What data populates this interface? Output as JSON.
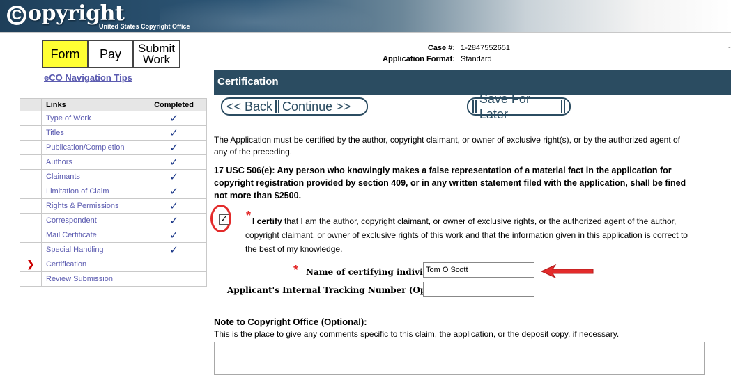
{
  "header": {
    "logo_text": "opyright",
    "logo_c": "C",
    "subtitle": "United States Copyright Office"
  },
  "tabs": [
    {
      "label": "Form",
      "active": true
    },
    {
      "label": "Pay",
      "active": false
    },
    {
      "label_line1": "Submit",
      "label_line2": "Work",
      "active": false
    }
  ],
  "nav_tips": "eCO Navigation Tips",
  "links_table": {
    "headers": [
      "",
      "Links",
      "Completed"
    ],
    "rows": [
      {
        "link": "Type of Work",
        "completed": "✓"
      },
      {
        "link": "Titles",
        "completed": "✓"
      },
      {
        "link": "Publication/Completion",
        "completed": "✓"
      },
      {
        "link": "Authors",
        "completed": "✓"
      },
      {
        "link": "Claimants",
        "completed": "✓"
      },
      {
        "link": "Limitation of Claim",
        "completed": "✓"
      },
      {
        "link": "Rights & Permissions",
        "completed": "✓"
      },
      {
        "link": "Correspondent",
        "completed": "✓"
      },
      {
        "link": "Mail Certificate",
        "completed": "✓"
      },
      {
        "link": "Special Handling",
        "completed": "✓"
      },
      {
        "link": "Certification",
        "completed": "",
        "current": "❯"
      },
      {
        "link": "Review Submission",
        "completed": ""
      }
    ]
  },
  "case_info": {
    "case_label": "Case #:",
    "case_value": "1-2847552651",
    "format_label": "Application Format:",
    "format_value": "Standard"
  },
  "section_title": "Certification",
  "buttons": {
    "back": "<< Back",
    "continue": "Continue >>",
    "save": "Save For Later"
  },
  "intro_text": "The Application must be certified by the author, copyright claimant, or owner of exclusive right(s), or by the authorized agent of any of the preceding.",
  "law_text": "17 USC 506(e): Any person who knowingly makes a false representation of a material fact in the application for copyright registration provided by section 409, or in any written statement filed with the application, shall be fined not more than $2500.",
  "certify": {
    "checked": true,
    "check_glyph": "✓",
    "star": "*",
    "bold": "I certify",
    "text": " that I am the author, copyright claimant, or owner of exclusive rights, or the authorized agent of the author, copyright claimant, or owner of exclusive rights of this work and that the information given in this application is correct to the best of my knowledge."
  },
  "fields": {
    "name_star": "*",
    "name_label": "Name of certifying individual:",
    "name_value": "Tom O Scott",
    "tracking_label": "Applicant's Internal Tracking Number (Optional):",
    "tracking_value": ""
  },
  "note": {
    "title": "Note to Copyright Office (Optional):",
    "description": "This is the place to give any comments specific to this claim, the application, or the deposit copy, if necessary.",
    "value": ""
  },
  "annotation_color": "#e32b2b",
  "edge_tick": "-"
}
